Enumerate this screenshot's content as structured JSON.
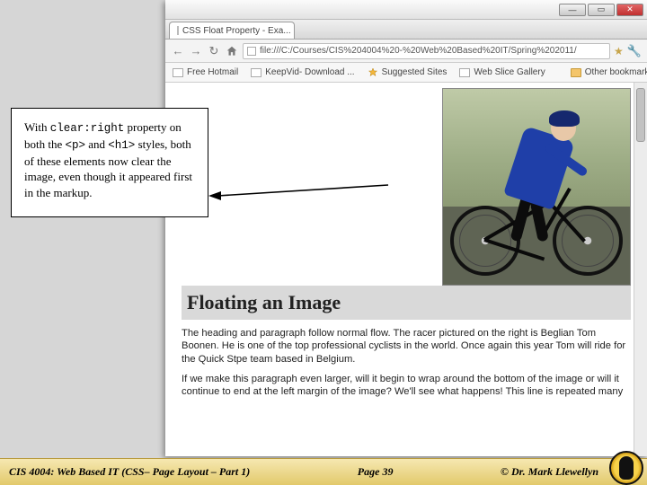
{
  "browser": {
    "tab": {
      "title": "CSS Float Property - Exa..."
    },
    "nav": {
      "back": "←",
      "fwd": "→",
      "reload": "↻"
    },
    "url": "file:///C:/Courses/CIS%204004%20-%20Web%20Based%20IT/Spring%202011/",
    "bookmarks": {
      "b1": "Free Hotmail",
      "b2": "KeepVid- Download ...",
      "b3": "Suggested Sites",
      "b4": "Web Slice Gallery",
      "other": "Other bookmarks"
    }
  },
  "page": {
    "heading": "Floating an Image",
    "p1": "The heading and paragraph follow normal flow. The racer pictured on the right is Beglian Tom Boonen. He is one of the top professional cyclists in the world. Once again this year Tom will ride for the Quick Stpe team based in Belgium.",
    "p2": "If we make this paragraph even larger, will it begin to wrap around the bottom of the image or will it continue to end at the left margin of the image? We'll see what happens! This line is repeated many"
  },
  "annotation": {
    "pre": "With ",
    "code1": "clear:right",
    "mid1": " property on both the ",
    "code2": "<p>",
    "mid2": " and ",
    "code3": "<h1>",
    "post": " styles, both of these elements now clear the image, even though it appeared first in the markup."
  },
  "footer": {
    "course": "CIS 4004: Web Based IT (CSS– Page Layout – Part 1)",
    "page": "Page 39",
    "copy": "© Dr. Mark Llewellyn"
  }
}
